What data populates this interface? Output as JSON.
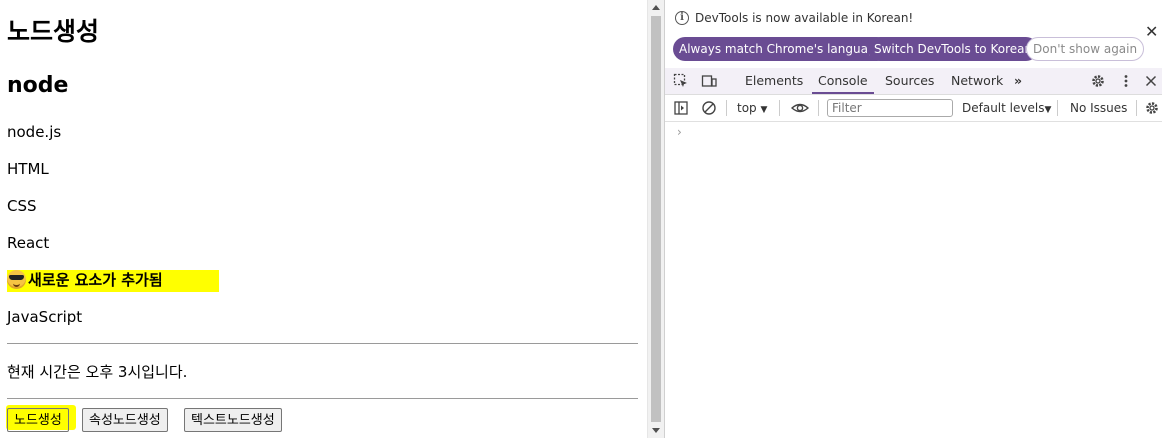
{
  "page": {
    "heading1": "노드생성",
    "heading2": "node",
    "items": [
      "node.js",
      "HTML",
      "CSS",
      "React"
    ],
    "new_item": "새로운 요소가 추가됨",
    "last_item": "JavaScript",
    "time_text": "현재 시간은 오후 3시입니다.",
    "buttons": [
      "노드생성",
      "속성노드생성",
      "텍스트노드생성"
    ],
    "highlight_color": "#ffff00"
  },
  "devtools": {
    "info_text": "DevTools is now available in Korean!",
    "pills": [
      "Always match Chrome's language",
      "Switch DevTools to Korean",
      "Don't show again"
    ],
    "tabs": [
      "Elements",
      "Console",
      "Sources",
      "Network"
    ],
    "active_tab": "Console",
    "context": "top",
    "filter_placeholder": "Filter",
    "levels": "Default levels",
    "issues": "No Issues",
    "accent_color": "#6a4c93"
  }
}
